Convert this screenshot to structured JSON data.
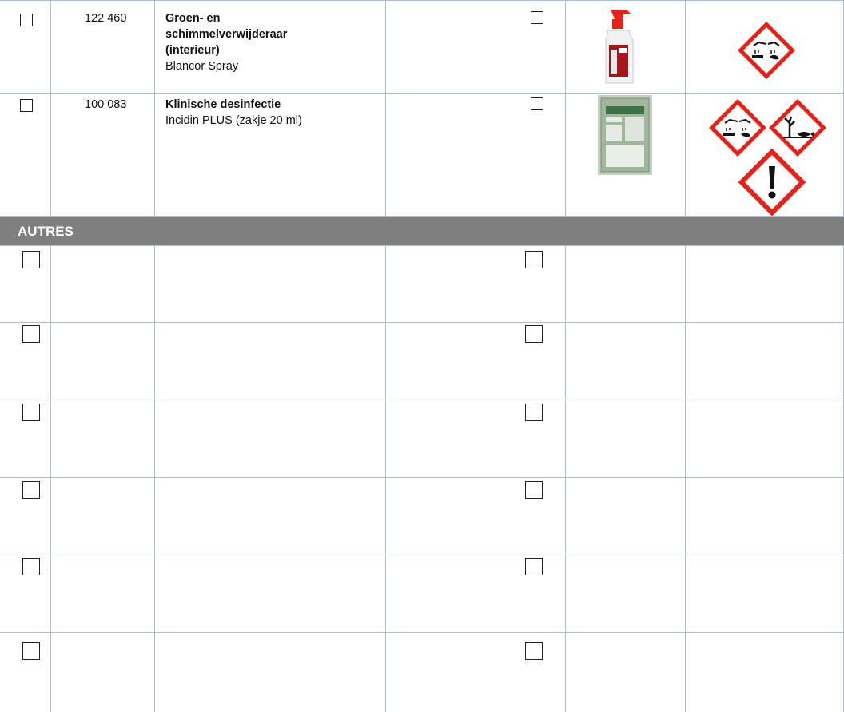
{
  "products": [
    {
      "code": "122 460",
      "name_lines": [
        "Groen- en",
        "schimmelverwijderaar",
        "(interieur)"
      ],
      "brand": "Blancor Spray",
      "image": "spray-bottle",
      "hazard_icons": [
        "corrosive-pictogram"
      ]
    },
    {
      "code": "100 083",
      "name_lines": [
        "Klinische desinfectie"
      ],
      "brand": "Incidin PLUS (zakje 20 ml)",
      "image": "sachet",
      "hazard_icons": [
        "corrosive-pictogram",
        "environment-pictogram",
        "exclamation-pictogram"
      ]
    }
  ],
  "section": {
    "label": "AUTRES"
  },
  "empty_rows_count": 6,
  "colors": {
    "grid": "#a9bdd8",
    "band": "#7f7f7f",
    "ghs_red": "#e2231a"
  }
}
